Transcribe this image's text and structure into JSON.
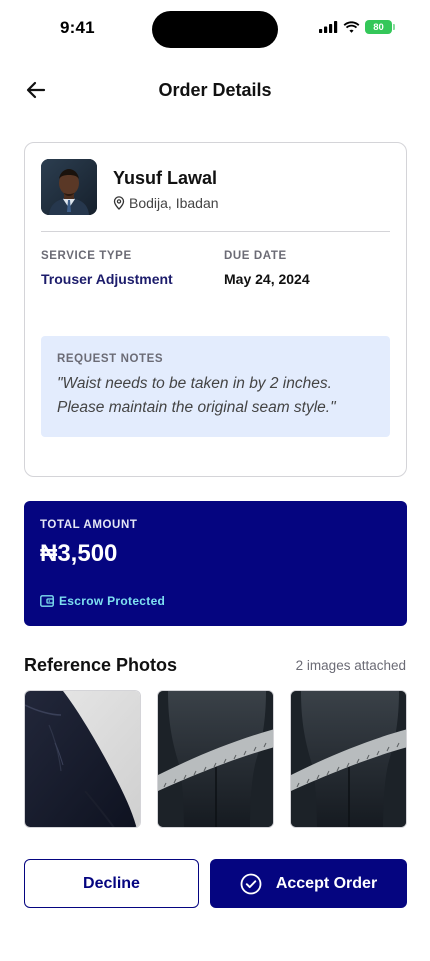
{
  "status_bar": {
    "time": "9:41",
    "battery": "80"
  },
  "header": {
    "title": "Order Details"
  },
  "customer": {
    "name": "Yusuf Lawal",
    "location": "Bodija, Ibadan"
  },
  "order": {
    "service_type_label": "SERVICE TYPE",
    "service_type": "Trouser Adjustment",
    "due_date_label": "DUE DATE",
    "due_date": "May 24, 2024",
    "notes_label": "REQUEST NOTES",
    "notes": "\"Waist needs to be taken in by 2 inches. Please maintain the original seam style.\""
  },
  "payment": {
    "total_label": "TOTAL AMOUNT",
    "total": "₦3,500",
    "escrow_label": "Escrow Protected"
  },
  "photos": {
    "title": "Reference Photos",
    "count_text": "2 images attached"
  },
  "actions": {
    "decline": "Decline",
    "accept": "Accept Order"
  },
  "colors": {
    "primary": "#050580",
    "service_text": "#1c1c6b",
    "notes_bg": "#e3ecfd",
    "escrow_text": "#7ee0f0",
    "battery": "#34c759"
  },
  "icons": {
    "back": "arrow-left-icon",
    "location": "map-pin-icon",
    "escrow": "wallet-icon",
    "accept": "check-circle-icon"
  }
}
